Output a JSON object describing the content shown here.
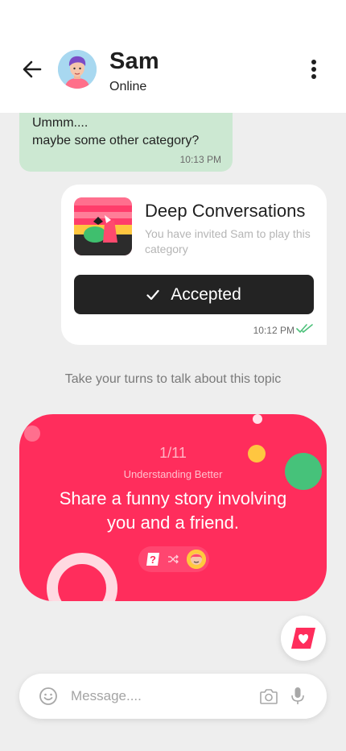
{
  "header": {
    "name": "Sam",
    "status": "Online"
  },
  "incoming_message": {
    "line1": "Ummm....",
    "line2": "maybe some other category?",
    "time": "10:13 PM"
  },
  "invite_card": {
    "title": "Deep Conversations",
    "subtitle": "You have invited Sam to play this category",
    "button_label": "Accepted",
    "time": "10:12 PM"
  },
  "hint": "Take your turns to talk about this topic",
  "question_card": {
    "counter": "1/11",
    "category": "Understanding Better",
    "question": "Share a funny story involving you and a friend.",
    "color": "#ff2d5c"
  },
  "composer": {
    "placeholder": "Message...."
  },
  "icons": {
    "back": "arrow-left-icon",
    "menu": "more-vertical-icon",
    "emoji": "smiley-icon",
    "camera": "camera-icon",
    "mic": "microphone-icon",
    "fab": "heart-card-icon"
  },
  "colors": {
    "incoming_bubble": "#cce8d2",
    "accent": "#ff2d5c",
    "button": "#232323",
    "read_ticks": "#4cc17a"
  }
}
